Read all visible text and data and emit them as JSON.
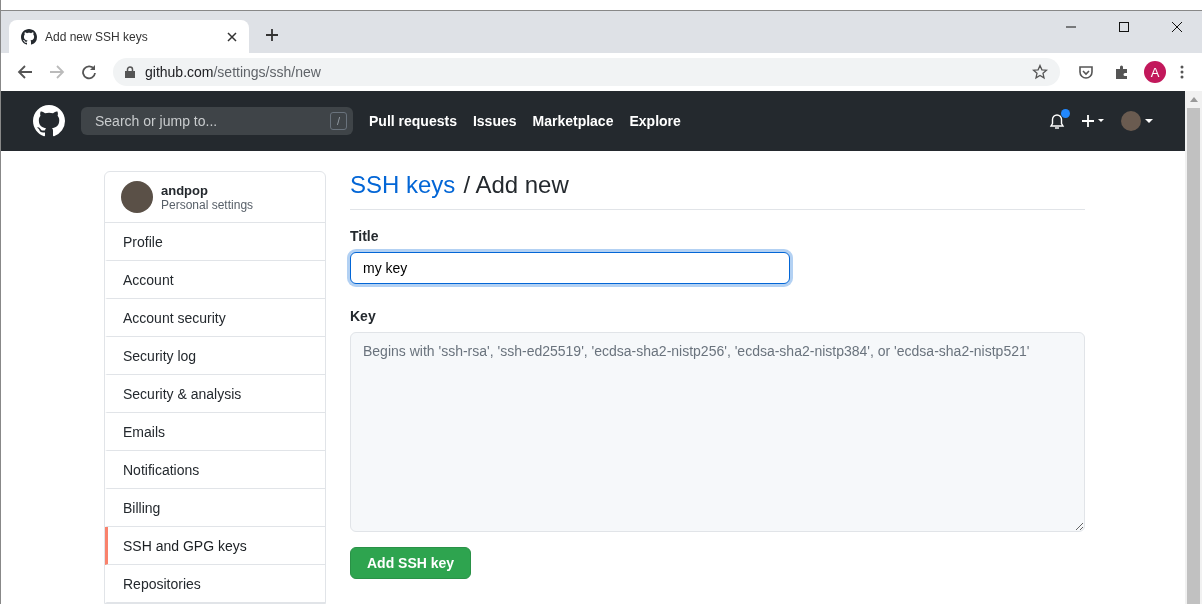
{
  "browser": {
    "tab": {
      "title": "Add new SSH keys"
    },
    "url": {
      "host": "github.com",
      "path": "/settings/ssh/new"
    },
    "profile_letter": "A"
  },
  "header": {
    "search": {
      "placeholder": "Search or jump to...",
      "shortcut": "/"
    },
    "nav": [
      "Pull requests",
      "Issues",
      "Marketplace",
      "Explore"
    ],
    "has_notification": true
  },
  "sidebar": {
    "user": {
      "name": "andpop",
      "subtitle": "Personal settings"
    },
    "items": [
      {
        "label": "Profile",
        "selected": false
      },
      {
        "label": "Account",
        "selected": false
      },
      {
        "label": "Account security",
        "selected": false
      },
      {
        "label": "Security log",
        "selected": false
      },
      {
        "label": "Security & analysis",
        "selected": false
      },
      {
        "label": "Emails",
        "selected": false
      },
      {
        "label": "Notifications",
        "selected": false
      },
      {
        "label": "Billing",
        "selected": false
      },
      {
        "label": "SSH and GPG keys",
        "selected": true
      },
      {
        "label": "Repositories",
        "selected": false
      }
    ]
  },
  "main": {
    "breadcrumb": {
      "link": "SSH keys",
      "rest": "/ Add new"
    },
    "title_field": {
      "label": "Title",
      "value": "my key"
    },
    "key_field": {
      "label": "Key",
      "placeholder": "Begins with 'ssh-rsa', 'ssh-ed25519', 'ecdsa-sha2-nistp256', 'ecdsa-sha2-nistp384', or 'ecdsa-sha2-nistp521'"
    },
    "submit": "Add SSH key"
  }
}
